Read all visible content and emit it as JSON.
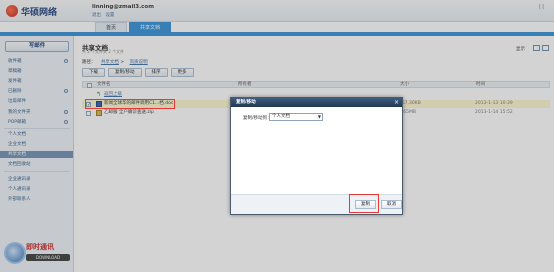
{
  "header": {
    "logo_text": "华硕网络",
    "user_email": "linning@zmail3.com",
    "user_links": [
      "退出",
      "设置"
    ],
    "top_right": "| |"
  },
  "tabs": [
    {
      "label": "首页",
      "active": false
    },
    {
      "label": "共享文档",
      "active": true
    }
  ],
  "sidebar": {
    "write_button": "写邮件",
    "items": [
      "收件箱",
      "草稿箱",
      "发件箱",
      "已删除",
      "垃圾邮件",
      "我的文件夹",
      "POP邮箱"
    ],
    "doc_items": [
      "个人文档",
      "企业文档",
      "共享文档",
      "文档回收站"
    ],
    "selected_doc": "共享文档",
    "contact_items": [
      "企业通讯录",
      "个人通讯录",
      "外部联系人"
    ],
    "im": {
      "title": "即时通讯",
      "download": "DOWNLOAD"
    }
  },
  "main": {
    "title": "共享文档",
    "subtitle": "共 2 个文件夹 2 个文件",
    "right_label": "显示",
    "path_label": "路径：",
    "path_links": [
      "共享文档",
      "资质说明"
    ],
    "toolbar": [
      "下载",
      "复制/移动",
      "排序",
      "更多"
    ],
    "columns": [
      "文件名",
      "所有者",
      "大小",
      "时间"
    ],
    "rows": [
      {
        "name": "返回上级",
        "owner": "",
        "size": "",
        "time": "",
        "checked": false,
        "selected": false
      },
      {
        "name": "新闻全球华的邮件调用C1...档.doc",
        "owner": "",
        "size": "357.30KB",
        "time": "2013-1-13 10:39",
        "checked": true,
        "selected": true
      },
      {
        "name": "乙邮服 全户确诊查送.zip",
        "owner": "",
        "size": "3.65MB",
        "time": "2013-1-14 15:52",
        "checked": false,
        "selected": false
      }
    ]
  },
  "dialog": {
    "title": "复制/移动",
    "close": "×",
    "label": "复制/移动到：",
    "select_value": "个人文档",
    "confirm": "复制",
    "cancel": "取消"
  },
  "colors": {
    "accent": "#2f8fd7",
    "highlight": "#e53935",
    "dialog_header": "#22384f"
  }
}
